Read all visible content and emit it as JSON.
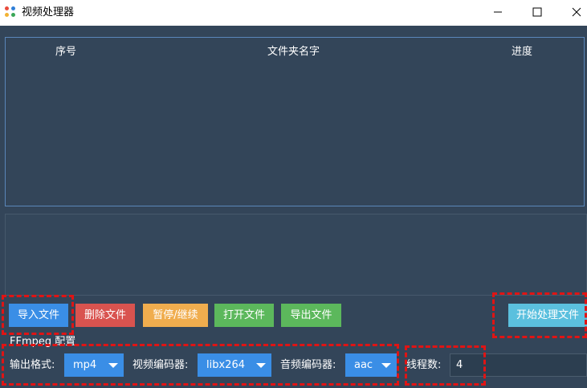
{
  "window": {
    "title": "视频处理器",
    "app_icon": "colorful-dots-icon"
  },
  "table": {
    "columns": [
      "序号",
      "文件夹名字",
      "进度"
    ],
    "rows": []
  },
  "toolbar": {
    "import_label": "导入文件",
    "delete_label": "删除文件",
    "pause_label": "暂停/继续",
    "open_label": "打开文件",
    "export_label": "导出文件",
    "start_label": "开始处理文件"
  },
  "ffmpeg": {
    "section_label": "FFmpeg 配置",
    "format_label": "输出格式:",
    "format_value": "mp4",
    "video_codec_label": "视频编码器:",
    "video_codec_value": "libx264",
    "audio_codec_label": "音频编码器:",
    "audio_codec_value": "aac",
    "threads_label": "线程数:",
    "threads_value": "4"
  },
  "colors": {
    "background": "#334559",
    "import": "#3a8ee6",
    "delete": "#d9534f",
    "pause": "#f0ad4e",
    "open": "#5cb85c",
    "export": "#5cb85c",
    "start": "#5bc0de",
    "highlight": "#e01414"
  }
}
